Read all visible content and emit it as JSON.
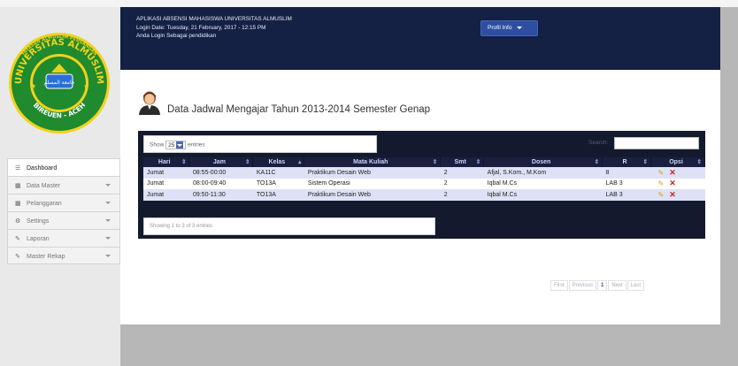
{
  "header": {
    "app_title": "APLIKASI ABSENSI MAHASISWA UNIVERSITAS ALMUSLIM",
    "login_date": "Login Date: Tuesday, 21 February, 2017 - 12:15 PM",
    "login_as": "Anda Login Sebagai pendidikan",
    "profil_button": "Profil Info"
  },
  "logo": {
    "top_text": "UNIVERSITAS ALMUSLIM",
    "arc_text": "YAYASAN ALMUSLIM PEUSANGAN",
    "bottom_text": "BIREUEN - ACEH",
    "center_text": "جامعة المسلم"
  },
  "page": {
    "title": "Data Jadwal Mengajar Tahun 2013-2014 Semester Genap"
  },
  "table_controls": {
    "show_label": "Show",
    "show_value": "25",
    "entries_label": "entries",
    "search_label": "Search:"
  },
  "table": {
    "columns": [
      "Hari",
      "Jam",
      "Kelas",
      "Mata Kuliah",
      "Smt",
      "Dosen",
      "R",
      "Opsi"
    ],
    "rows": [
      [
        "Jumat",
        "08:55-00:00",
        "KA11C",
        "Praktikum Desain Web",
        "2",
        "Afjal, S.Kom., M.Kom",
        "8"
      ],
      [
        "Jumat",
        "08:00-09:40",
        "TO13A",
        "Sistem Operasi",
        "2",
        "Iqbal M.Cs",
        "LAB 3"
      ],
      [
        "Jumat",
        "09:50-11:30",
        "TO13A",
        "Praktikum Desain Web",
        "2",
        "Iqbal M.Cs",
        "LAB 3"
      ]
    ],
    "info": "Showing 1 to 3 of 3 entries"
  },
  "pagination": {
    "first": "First",
    "previous": "Previous",
    "current": "1",
    "next": "Next",
    "last": "Last"
  },
  "sidebar": {
    "items": [
      {
        "label": "Dashboard",
        "icon": "list-icon"
      },
      {
        "label": "Data Master",
        "icon": "table-icon"
      },
      {
        "label": "Pelanggaran",
        "icon": "table-icon"
      },
      {
        "label": "Settings",
        "icon": "cogs-icon"
      },
      {
        "label": "Laporan",
        "icon": "pencil-icon"
      },
      {
        "label": "Master Rekap",
        "icon": "pencil-icon"
      }
    ]
  },
  "colors": {
    "header_bg": "#142044",
    "table_dark": "#141a2e",
    "row_highlight": "#dfe2f6",
    "logo_green": "#1f8a2e",
    "logo_yellow": "#f1d21a"
  }
}
